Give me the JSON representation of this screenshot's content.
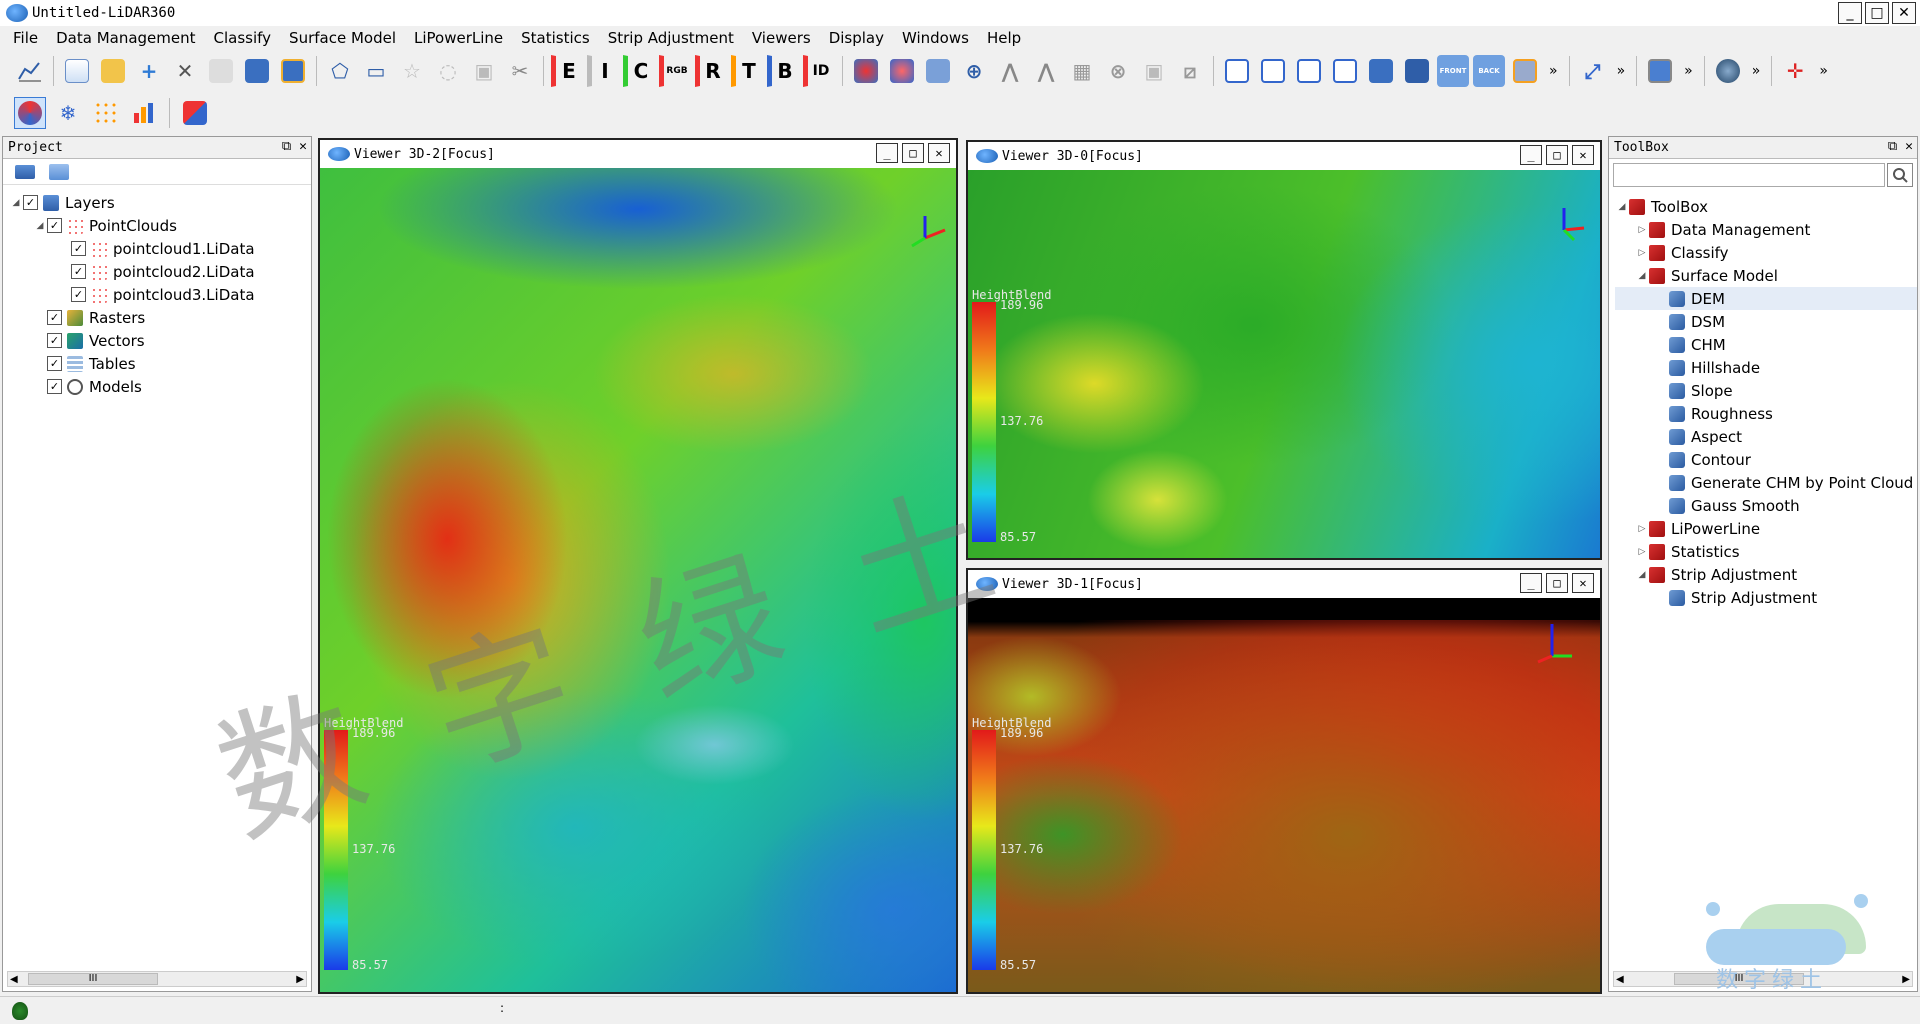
{
  "window": {
    "title": "Untitled-LiDAR360"
  },
  "menubar": {
    "items": [
      "File",
      "Data Management",
      "Classify",
      "Surface Model",
      "LiPowerLine",
      "Statistics",
      "Strip Adjustment",
      "Viewers",
      "Display",
      "Windows",
      "Help"
    ]
  },
  "toolbar_letters": {
    "e": "E",
    "i": "I",
    "c": "C",
    "rgb": "RGB",
    "r": "R",
    "t": "T",
    "b": "B",
    "id": "ID",
    "front": "FRONT",
    "back": "BACK",
    "more": "»"
  },
  "project": {
    "title": "Project",
    "tree": {
      "layers": "Layers",
      "pointclouds": "PointClouds",
      "pc1": "pointcloud1.LiData",
      "pc2": "pointcloud2.LiData",
      "pc3": "pointcloud3.LiData",
      "rasters": "Rasters",
      "vectors": "Vectors",
      "tables": "Tables",
      "models": "Models"
    }
  },
  "toolbox": {
    "title": "ToolBox",
    "search_placeholder": "",
    "tree": {
      "root": "ToolBox",
      "data_management": "Data Management",
      "classify": "Classify",
      "surface_model": "Surface Model",
      "dem": "DEM",
      "dsm": "DSM",
      "chm": "CHM",
      "hillshade": "Hillshade",
      "slope": "Slope",
      "roughness": "Roughness",
      "aspect": "Aspect",
      "contour": "Contour",
      "gen_chm": "Generate CHM by Point Cloud",
      "gauss": "Gauss Smooth",
      "lipowerline": "LiPowerLine",
      "statistics": "Statistics",
      "strip_adjustment": "Strip Adjustment",
      "strip_adjustment_tool": "Strip Adjustment"
    }
  },
  "viewers": {
    "v2": {
      "title": "Viewer 3D-2[Focus]",
      "legend_title": "HeightBlend",
      "max": "189.96",
      "mid": "137.76",
      "min": "85.57"
    },
    "v0": {
      "title": "Viewer 3D-0[Focus]",
      "legend_title": "HeightBlend",
      "max": "189.96",
      "mid": "137.76",
      "min": "85.57"
    },
    "v1": {
      "title": "Viewer 3D-1[Focus]",
      "legend_title": "HeightBlend",
      "max": "189.96",
      "mid": "137.76",
      "min": "85.57"
    }
  },
  "watermark": {
    "text": "数字绿土",
    "diag": "数字绿土"
  },
  "statusbar": {
    "dots": ":"
  },
  "scroll_grip": "III",
  "colors": {
    "accent": "#3a7bd5",
    "legend_top": "#e21a1a",
    "legend_bottom": "#1a3ae8"
  }
}
